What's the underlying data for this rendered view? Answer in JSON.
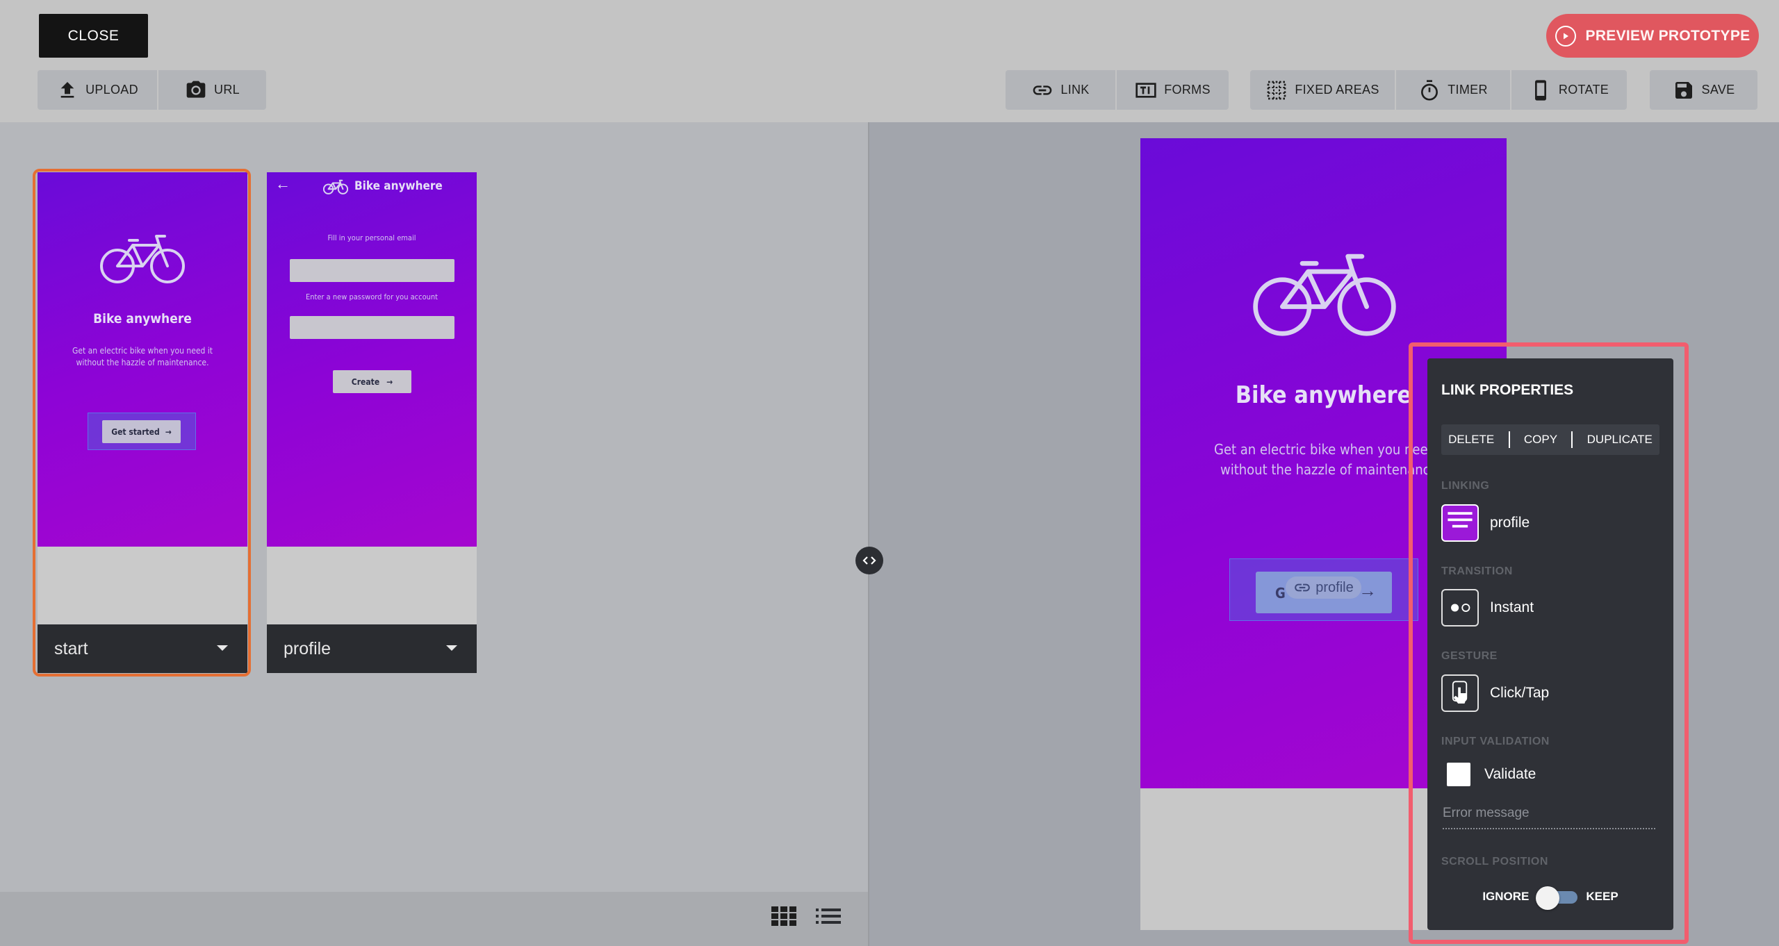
{
  "toolbar": {
    "close": "CLOSE",
    "preview": "PREVIEW PROTOTYPE",
    "upload": "UPLOAD",
    "url": "URL",
    "link": "LINK",
    "forms": "FORMS",
    "fixed_areas": "FIXED AREAS",
    "timer": "TIMER",
    "rotate": "ROTATE",
    "save": "SAVE"
  },
  "screens": [
    {
      "name": "start",
      "title": "Bike anywhere",
      "subtitle_line1": "Get an electric bike when you need it",
      "subtitle_line2": "without the hazzle of maintenance.",
      "button": "Get started"
    },
    {
      "name": "profile",
      "title": "Bike anywhere",
      "email_label": "Fill in your personal email",
      "password_label": "Enter a new password for you account",
      "button": "Create"
    }
  ],
  "preview": {
    "title": "Bike anywhere",
    "subtitle_line1": "Get an electric bike when you nee",
    "subtitle_line2": "without the hazzle of maintenanc",
    "button_partial": "G",
    "link_target": "profile"
  },
  "link_properties": {
    "title": "LINK PROPERTIES",
    "actions": [
      "DELETE",
      "COPY",
      "DUPLICATE"
    ],
    "linking_label": "LINKING",
    "linking_value": "profile",
    "transition_label": "TRANSITION",
    "transition_value": "Instant",
    "gesture_label": "GESTURE",
    "gesture_value": "Click/Tap",
    "validation_label": "INPUT VALIDATION",
    "validate_label": "Validate",
    "validate_checked": false,
    "error_placeholder": "Error message",
    "scroll_label": "SCROLL POSITION",
    "scroll_ignore": "IGNORE",
    "scroll_keep": "KEEP"
  },
  "colors": {
    "accent_red": "#e0575f",
    "highlight": "#f25d6e",
    "selected_border": "#e56f33",
    "gradient_start": "#6a0bd8",
    "gradient_end": "#a506cf",
    "panel_bg": "#2f3137"
  }
}
